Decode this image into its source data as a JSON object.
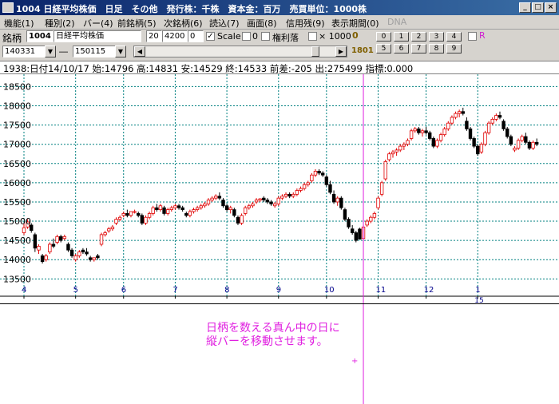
{
  "window": {
    "title": "1004 日経平均株価　日足　その他　発行株：千株　資本金：百万　売買単位：1000株",
    "buttons": [
      "_",
      "□",
      "×"
    ]
  },
  "menu": [
    {
      "label": "機能(1)"
    },
    {
      "label": "種別(2)"
    },
    {
      "label": "バー(4)"
    },
    {
      "label": "前銘柄(5)"
    },
    {
      "label": "次銘柄(6)"
    },
    {
      "label": "読込(7)"
    },
    {
      "label": "画面(8)"
    },
    {
      "label": "信用残(9)"
    },
    {
      "label": "表示期間(0)"
    },
    {
      "label": "DNA"
    }
  ],
  "toolbar": {
    "code_label": "銘柄",
    "code": "1004",
    "name": "日経平均株価",
    "field1": "20",
    "field2": "4200",
    "field3": "0",
    "scale_label": "Scale",
    "scale_checked": "✓",
    "zero_value": "0",
    "kenri_label": "権利落",
    "x1000_label": "× 1000",
    "small_val": "0",
    "date_from": "140331",
    "dash": "―",
    "date_to": "150115",
    "code2": "1801",
    "num_row1": [
      "0",
      "1",
      "2",
      "3",
      "4"
    ],
    "num_row2": [
      "5",
      "6",
      "7",
      "8",
      "9"
    ],
    "r_label": "R"
  },
  "info": {
    "text": "1938:日付14/10/17  始:14796  高:14831  安:14529  終:14533  前差:-205  出:275499  指標:0.000"
  },
  "colors": {
    "up": "#e00000",
    "down": "#000000",
    "grid": "#008080",
    "cursor": "#e020e0"
  },
  "chart_data": {
    "type": "candlestick",
    "y_ticks": [
      13500,
      14000,
      14500,
      15000,
      15500,
      16000,
      16500,
      17000,
      17500,
      18000,
      18500
    ],
    "ylim": [
      13050,
      18820
    ],
    "x_labels": [
      {
        "label": "4",
        "pos": 0
      },
      {
        "label": "5",
        "pos": 14
      },
      {
        "label": "6",
        "pos": 27
      },
      {
        "label": "7",
        "pos": 41
      },
      {
        "label": "8",
        "pos": 55
      },
      {
        "label": "9",
        "pos": 69
      },
      {
        "label": "10",
        "pos": 82
      },
      {
        "label": "11",
        "pos": 96
      },
      {
        "label": "12",
        "pos": 109
      },
      {
        "label": "1",
        "pos": 123
      }
    ],
    "year_label": "15",
    "cursor_pos": 92,
    "bars": [
      [
        0,
        14700,
        14950,
        14640,
        14830
      ],
      [
        1,
        14850,
        15050,
        14800,
        14980
      ],
      [
        2,
        14900,
        14950,
        14700,
        14760
      ],
      [
        3,
        14650,
        14700,
        14200,
        14300
      ],
      [
        4,
        14250,
        14400,
        14150,
        14350
      ],
      [
        5,
        14100,
        14150,
        13900,
        13950
      ],
      [
        6,
        14000,
        14150,
        13950,
        14100
      ],
      [
        7,
        14200,
        14450,
        14150,
        14400
      ],
      [
        8,
        14400,
        14550,
        14300,
        14350
      ],
      [
        9,
        14450,
        14650,
        14400,
        14600
      ],
      [
        10,
        14600,
        14650,
        14450,
        14500
      ],
      [
        11,
        14550,
        14650,
        14500,
        14600
      ],
      [
        12,
        14400,
        14450,
        14200,
        14250
      ],
      [
        13,
        14250,
        14300,
        14050,
        14100
      ],
      [
        14,
        14000,
        14150,
        13950,
        14100
      ],
      [
        15,
        14100,
        14250,
        14050,
        14200
      ],
      [
        16,
        14250,
        14300,
        14150,
        14200
      ],
      [
        17,
        14200,
        14300,
        14100,
        14150
      ],
      [
        18,
        14050,
        14100,
        13950,
        14000
      ],
      [
        19,
        14000,
        14050,
        13950,
        14050
      ],
      [
        20,
        14100,
        14150,
        14000,
        14050
      ],
      [
        21,
        14400,
        14700,
        14350,
        14650
      ],
      [
        22,
        14650,
        14750,
        14600,
        14700
      ],
      [
        23,
        14750,
        14850,
        14700,
        14800
      ],
      [
        24,
        14800,
        14900,
        14750,
        14850
      ],
      [
        25,
        14950,
        15100,
        14900,
        15050
      ],
      [
        26,
        15050,
        15150,
        15000,
        15100
      ],
      [
        27,
        15150,
        15250,
        15100,
        15200
      ],
      [
        28,
        15200,
        15300,
        15100,
        15150
      ],
      [
        29,
        15150,
        15250,
        15100,
        15250
      ],
      [
        30,
        15250,
        15300,
        15200,
        15250
      ],
      [
        31,
        15200,
        15250,
        15100,
        15150
      ],
      [
        32,
        15150,
        15200,
        14900,
        14950
      ],
      [
        33,
        14950,
        15150,
        14900,
        15100
      ],
      [
        34,
        15100,
        15250,
        15050,
        15200
      ],
      [
        35,
        15200,
        15400,
        15150,
        15350
      ],
      [
        36,
        15350,
        15450,
        15250,
        15300
      ],
      [
        37,
        15300,
        15450,
        15250,
        15400
      ],
      [
        38,
        15350,
        15400,
        15150,
        15200
      ],
      [
        39,
        15200,
        15350,
        15150,
        15300
      ],
      [
        40,
        15300,
        15400,
        15250,
        15350
      ],
      [
        41,
        15350,
        15450,
        15300,
        15400
      ],
      [
        42,
        15400,
        15450,
        15300,
        15350
      ],
      [
        43,
        15350,
        15400,
        15250,
        15300
      ],
      [
        44,
        15200,
        15250,
        15100,
        15150
      ],
      [
        45,
        15150,
        15300,
        15100,
        15250
      ],
      [
        46,
        15250,
        15350,
        15200,
        15300
      ],
      [
        47,
        15300,
        15400,
        15250,
        15350
      ],
      [
        48,
        15350,
        15450,
        15300,
        15400
      ],
      [
        49,
        15400,
        15500,
        15350,
        15450
      ],
      [
        50,
        15450,
        15600,
        15400,
        15550
      ],
      [
        51,
        15550,
        15650,
        15500,
        15600
      ],
      [
        52,
        15600,
        15700,
        15550,
        15650
      ],
      [
        53,
        15650,
        15750,
        15550,
        15600
      ],
      [
        54,
        15550,
        15600,
        15350,
        15400
      ],
      [
        55,
        15400,
        15450,
        15250,
        15300
      ],
      [
        56,
        15300,
        15400,
        15200,
        15350
      ],
      [
        57,
        15300,
        15350,
        15100,
        15150
      ],
      [
        58,
        15100,
        15150,
        14900,
        14950
      ],
      [
        59,
        14950,
        15200,
        14900,
        15150
      ],
      [
        60,
        15200,
        15400,
        15150,
        15350
      ],
      [
        61,
        15350,
        15450,
        15300,
        15400
      ],
      [
        62,
        15400,
        15500,
        15350,
        15450
      ],
      [
        63,
        15500,
        15600,
        15450,
        15550
      ],
      [
        64,
        15550,
        15600,
        15500,
        15580
      ],
      [
        65,
        15600,
        15650,
        15500,
        15550
      ],
      [
        66,
        15550,
        15600,
        15450,
        15500
      ],
      [
        67,
        15500,
        15550,
        15400,
        15450
      ],
      [
        68,
        15400,
        15500,
        15350,
        15450
      ],
      [
        69,
        15450,
        15650,
        15400,
        15600
      ],
      [
        70,
        15600,
        15700,
        15550,
        15650
      ],
      [
        71,
        15650,
        15750,
        15600,
        15700
      ],
      [
        72,
        15700,
        15750,
        15600,
        15650
      ],
      [
        73,
        15650,
        15750,
        15600,
        15700
      ],
      [
        74,
        15700,
        15850,
        15650,
        15800
      ],
      [
        75,
        15800,
        15900,
        15750,
        15850
      ],
      [
        76,
        15850,
        16000,
        15800,
        15950
      ],
      [
        77,
        15950,
        16050,
        15900,
        16000
      ],
      [
        78,
        16050,
        16250,
        16000,
        16200
      ],
      [
        79,
        16200,
        16350,
        16150,
        16300
      ],
      [
        80,
        16300,
        16350,
        16200,
        16250
      ],
      [
        81,
        16250,
        16300,
        16150,
        16200
      ],
      [
        82,
        16150,
        16200,
        15900,
        15950
      ],
      [
        83,
        15950,
        16050,
        15700,
        15750
      ],
      [
        84,
        15700,
        15800,
        15450,
        15500
      ],
      [
        85,
        15500,
        15650,
        15400,
        15600
      ],
      [
        86,
        15600,
        15650,
        15300,
        15350
      ],
      [
        87,
        15300,
        15350,
        15000,
        15050
      ],
      [
        88,
        15050,
        15100,
        14800,
        14850
      ],
      [
        89,
        14800,
        14900,
        14650,
        14700
      ],
      [
        90,
        14700,
        14750,
        14450,
        14500
      ],
      [
        91,
        14796,
        14831,
        14529,
        14533
      ],
      [
        92,
        14550,
        14900,
        14500,
        14850
      ],
      [
        93,
        14900,
        15050,
        14850,
        15000
      ],
      [
        94,
        15000,
        15150,
        14950,
        15100
      ],
      [
        95,
        15100,
        15250,
        15050,
        15200
      ],
      [
        96,
        15350,
        15650,
        15300,
        15600
      ],
      [
        97,
        15700,
        16050,
        15650,
        16000
      ],
      [
        98,
        16100,
        16600,
        16050,
        16550
      ],
      [
        99,
        16600,
        16800,
        16550,
        16750
      ],
      [
        100,
        16750,
        16850,
        16650,
        16800
      ],
      [
        101,
        16800,
        16900,
        16700,
        16850
      ],
      [
        102,
        16850,
        17000,
        16800,
        16950
      ],
      [
        103,
        16950,
        17050,
        16850,
        17000
      ],
      [
        104,
        17000,
        17150,
        16950,
        17100
      ],
      [
        105,
        17150,
        17400,
        17100,
        17350
      ],
      [
        106,
        17350,
        17450,
        17300,
        17400
      ],
      [
        107,
        17400,
        17450,
        17250,
        17300
      ],
      [
        108,
        17300,
        17400,
        17200,
        17350
      ],
      [
        109,
        17350,
        17450,
        17250,
        17300
      ],
      [
        110,
        17300,
        17350,
        17100,
        17150
      ],
      [
        111,
        17150,
        17200,
        16900,
        16950
      ],
      [
        112,
        16950,
        17150,
        16900,
        17100
      ],
      [
        113,
        17100,
        17300,
        17050,
        17250
      ],
      [
        114,
        17250,
        17450,
        17200,
        17400
      ],
      [
        115,
        17400,
        17600,
        17350,
        17550
      ],
      [
        116,
        17550,
        17750,
        17500,
        17700
      ],
      [
        117,
        17700,
        17850,
        17650,
        17800
      ],
      [
        118,
        17800,
        17900,
        17700,
        17850
      ],
      [
        119,
        17850,
        17950,
        17750,
        17800
      ],
      [
        120,
        17600,
        17700,
        17350,
        17400
      ],
      [
        121,
        17400,
        17450,
        17100,
        17150
      ],
      [
        122,
        17150,
        17200,
        16900,
        16950
      ],
      [
        123,
        16950,
        17000,
        16700,
        16750
      ],
      [
        124,
        16800,
        17050,
        16750,
        17000
      ],
      [
        125,
        17000,
        17350,
        16950,
        17300
      ],
      [
        126,
        17300,
        17600,
        17250,
        17550
      ],
      [
        127,
        17550,
        17700,
        17500,
        17650
      ],
      [
        128,
        17650,
        17800,
        17600,
        17750
      ],
      [
        129,
        17750,
        17850,
        17650,
        17700
      ],
      [
        130,
        17600,
        17650,
        17350,
        17400
      ],
      [
        131,
        17400,
        17450,
        17150,
        17200
      ],
      [
        132,
        17200,
        17250,
        16950,
        17000
      ],
      [
        133,
        16850,
        16950,
        16800,
        16900
      ],
      [
        134,
        16900,
        17150,
        16850,
        17100
      ],
      [
        135,
        17100,
        17250,
        17050,
        17200
      ],
      [
        136,
        17200,
        17300,
        17000,
        17050
      ],
      [
        137,
        17050,
        17100,
        16850,
        16900
      ],
      [
        138,
        16900,
        17100,
        16850,
        17050
      ],
      [
        139,
        17050,
        17150,
        16950,
        17000
      ]
    ]
  },
  "note": "日柄を数える真ん中の日に\n縦バーを移動させます。"
}
